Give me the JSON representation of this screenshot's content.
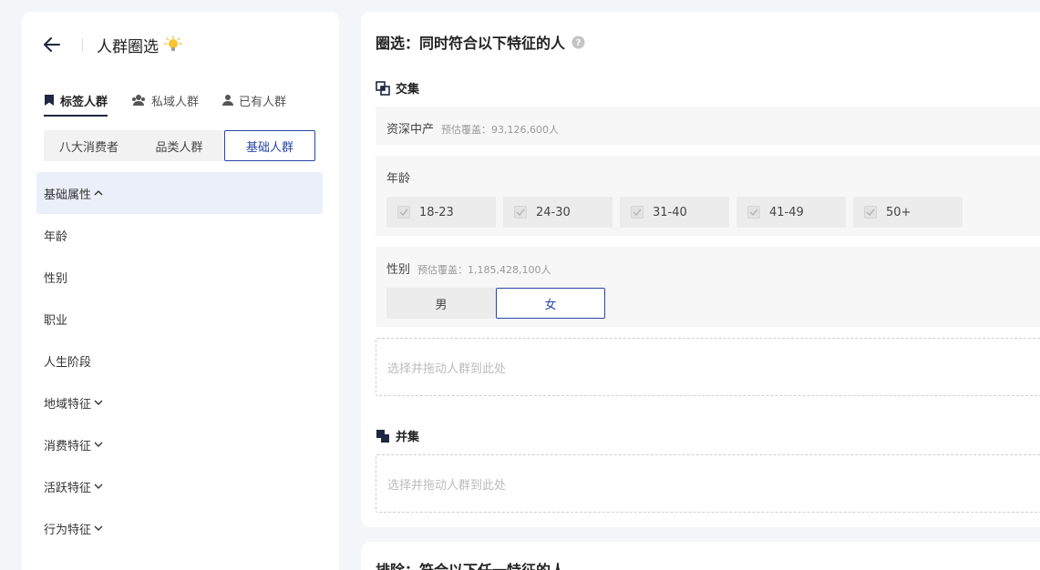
{
  "header": {
    "title": "人群圈选"
  },
  "tabs": [
    {
      "label": "标签人群",
      "icon": "bookmark-icon"
    },
    {
      "label": "私域人群",
      "icon": "group-icon"
    },
    {
      "label": "已有人群",
      "icon": "user-icon"
    }
  ],
  "segments": [
    "八大消费者",
    "品类人群",
    "基础人群"
  ],
  "categories": {
    "group_basic": "基础属性",
    "age": "年龄",
    "gender": "性别",
    "job": "职业",
    "life_stage": "人生阶段",
    "region": "地域特征",
    "consumption": "消费特征",
    "activity": "活跃特征",
    "behavior": "行为特征"
  },
  "main": {
    "title": "圈选：同时符合以下特征的人",
    "intersection_label": "交集",
    "union_label": "并集",
    "tag1": {
      "label": "资深中产",
      "estimate": "预估覆盖：93,126,600人"
    },
    "age": {
      "label": "年龄",
      "options": [
        "18-23",
        "24-30",
        "31-40",
        "41-49",
        "50+"
      ]
    },
    "gender": {
      "label": "性别",
      "estimate": "预估覆盖：1,185,428,100人",
      "options": [
        "男",
        "女"
      ],
      "selected": "女"
    },
    "dropzone_placeholder": "选择并拖动人群到此处",
    "exclude_title": "排除：符合以下任一特征的人"
  },
  "colors": {
    "accent": "#2a46a8",
    "dark": "#1f2742",
    "highlight": "#eaeff9"
  }
}
